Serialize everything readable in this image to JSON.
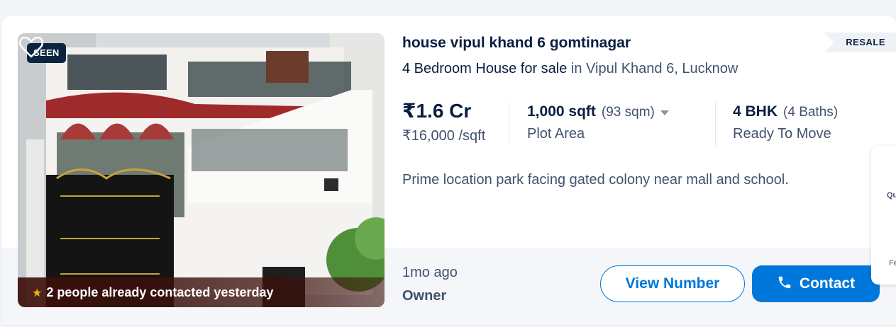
{
  "listing": {
    "seen_badge": "SEEN",
    "contacted_text": "2 people already contacted yesterday",
    "title": "house vipul khand 6 gomtinagar",
    "tag": "RESALE",
    "subtitle_main": "4 Bedroom House for sale",
    "subtitle_location": "in Vipul Khand 6, Lucknow",
    "price": "₹1.6 Cr",
    "price_per_sqft": "₹16,000 /sqft",
    "area": "1,000 sqft",
    "area_alt": "(93 sqm)",
    "area_label": "Plot Area",
    "config": "4 BHK",
    "baths": "(4 Baths)",
    "status": "Ready To Move",
    "description": "Prime location park facing gated colony near mall and school.",
    "posted": "1mo ago",
    "posted_by": "Owner",
    "view_number_label": "View Number",
    "contact_label": "Contact"
  },
  "side_panel": {
    "top_text": "Qu",
    "bottom_text": "Fe"
  },
  "colors": {
    "accent": "#0078db",
    "seen_bg": "#0c2340",
    "text_primary": "#091e42",
    "text_secondary": "#42526e"
  },
  "icons": [
    "heart-icon",
    "star-icon",
    "phone-icon",
    "caret-down-icon"
  ]
}
